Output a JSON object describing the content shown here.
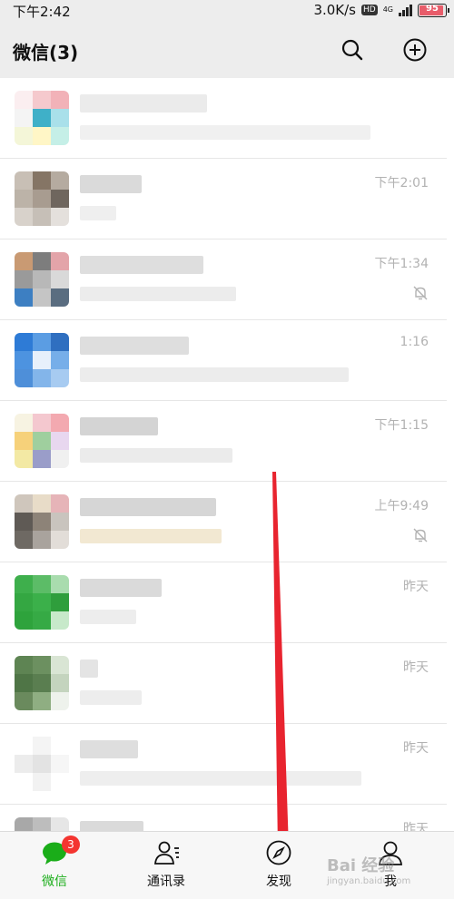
{
  "status_bar": {
    "time": "下午2:42",
    "net_speed": "3.0K/s",
    "hd": "HD",
    "network_type": "4G",
    "battery": "95"
  },
  "header": {
    "title": "微信(3)"
  },
  "chats": [
    {
      "time": ""
    },
    {
      "time": "下午2:01"
    },
    {
      "time": "下午1:34"
    },
    {
      "time": "1:16"
    },
    {
      "time": "下午1:15"
    },
    {
      "time": "上午9:49"
    },
    {
      "time": "昨天"
    },
    {
      "time": "昨天"
    },
    {
      "time": "昨天"
    },
    {
      "time": "昨天"
    }
  ],
  "tabs": [
    {
      "label": "微信",
      "badge": "3"
    },
    {
      "label": "通讯录"
    },
    {
      "label": "发现"
    },
    {
      "label": "我"
    }
  ],
  "watermark": {
    "text": "Bai 经验",
    "sub": "jingyan.baidu.com"
  },
  "colors": {
    "accent_green": "#1aad19",
    "badge_red": "#f43530",
    "annotation_red": "#e8242f"
  }
}
